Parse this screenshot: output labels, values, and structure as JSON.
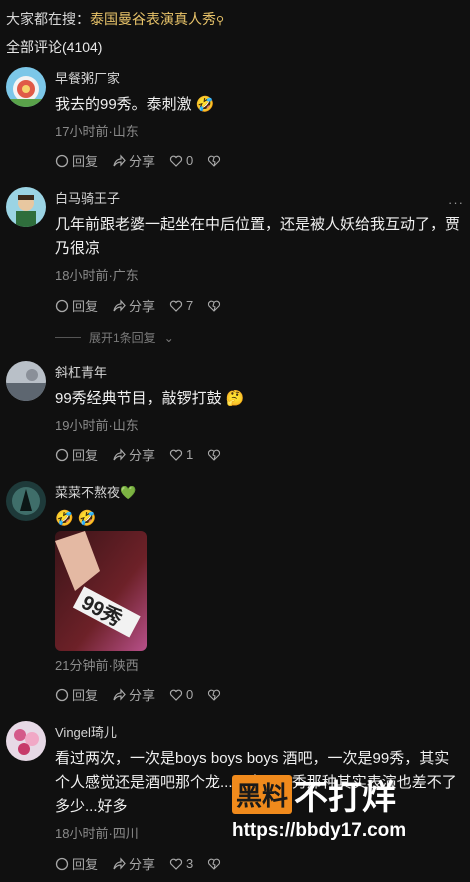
{
  "hot_search": {
    "prefix": "大家都在搜：",
    "keyword": "泰国曼谷表演真人秀",
    "icon": "search-icon"
  },
  "comment_count_label": "全部评论(4104)",
  "actions_labels": {
    "reply": "回复",
    "share": "分享"
  },
  "comments": [
    {
      "name": "早餐粥厂家",
      "text": "我去的99秀。泰刺激",
      "emoji": "🤣",
      "meta": "17小时前·山东",
      "likes": "0"
    },
    {
      "name": "白马骑王子",
      "text": "几年前跟老婆一起坐在中后位置，还是被人妖给我互动了，贾乃很凉",
      "meta": "18小时前·广东",
      "likes": "7",
      "more": "···",
      "expand_label": "展开1条回复"
    },
    {
      "name": "斜杠青年",
      "text": "99秀经典节目，敲锣打鼓",
      "emoji": "🤔",
      "meta": "19小时前·山东",
      "likes": "1"
    },
    {
      "name": "菜菜不熬夜",
      "name_emoji": "💚",
      "text": "🤣 🤣",
      "meta": "21分钟前·陕西",
      "likes": "0",
      "photo_text": "99秀"
    },
    {
      "name": "Vingel琦儿",
      "text": "看过两次，一次是boys boys boys 酒吧，一次是99秀，其实个人感觉还是酒吧那个龙...两米...99秀那种其实表演也差不了多少...好多",
      "meta": "18小时前·四川",
      "likes": "3"
    }
  ],
  "watermark": {
    "box": "黑料",
    "rest": "不打烊",
    "url": "https://bbdy17.com"
  }
}
